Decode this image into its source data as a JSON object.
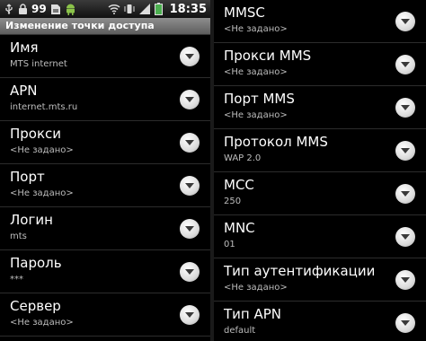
{
  "status": {
    "signal_number": "99",
    "time": "18:35"
  },
  "title": "Изменение точки доступа",
  "left_items": [
    {
      "label": "Имя",
      "value": "MTS internet"
    },
    {
      "label": "APN",
      "value": "internet.mts.ru"
    },
    {
      "label": "Прокси",
      "value": "<Не задано>"
    },
    {
      "label": "Порт",
      "value": "<Не задано>"
    },
    {
      "label": "Логин",
      "value": "mts"
    },
    {
      "label": "Пароль",
      "value": "***"
    },
    {
      "label": "Сервер",
      "value": "<Не задано>"
    }
  ],
  "right_items": [
    {
      "label": "MMSC",
      "value": "<Не задано>"
    },
    {
      "label": "Прокси MMS",
      "value": "<Не задано>"
    },
    {
      "label": "Порт MMS",
      "value": "<Не задано>"
    },
    {
      "label": "Протокол MMS",
      "value": "WAP 2.0"
    },
    {
      "label": "MCC",
      "value": "250"
    },
    {
      "label": "MNC",
      "value": "01"
    },
    {
      "label": "Тип аутентификации",
      "value": "<Не задано>"
    },
    {
      "label": "Тип APN",
      "value": "default"
    }
  ],
  "icons": {
    "status_bar": [
      "usb-icon",
      "lock-icon",
      "sim-icon",
      "android-icon",
      "wifi-icon",
      "vibrate-icon",
      "signal-icon",
      "battery-icon"
    ],
    "row_action": "chevron-down-icon"
  },
  "colors": {
    "background": "#000000",
    "title_bar": "#7a7a7a",
    "value_text": "#bdbdbd"
  }
}
